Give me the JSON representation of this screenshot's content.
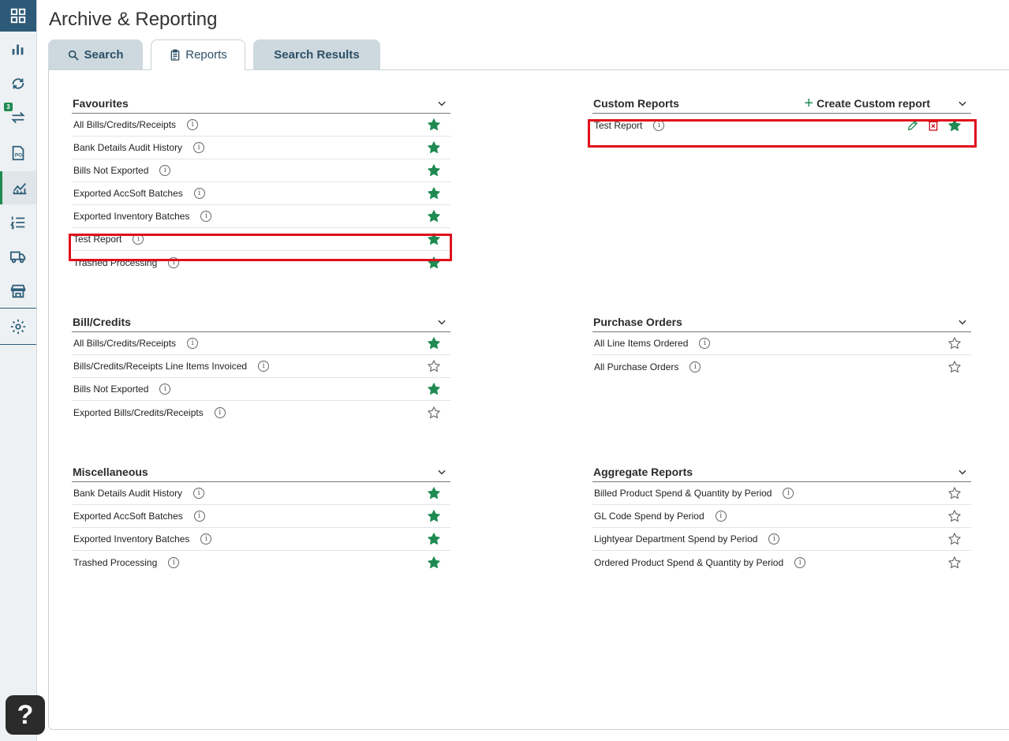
{
  "page": {
    "title": "Archive & Reporting"
  },
  "tabs": [
    {
      "label": "Search"
    },
    {
      "label": "Reports"
    },
    {
      "label": "Search Results"
    }
  ],
  "sidebar": {
    "badge": "3",
    "help": "?"
  },
  "sections": {
    "favourites": {
      "title": "Favourites",
      "items": [
        {
          "label": "All Bills/Credits/Receipts",
          "favourite": true
        },
        {
          "label": "Bank Details Audit History",
          "favourite": true
        },
        {
          "label": "Bills Not Exported",
          "favourite": true
        },
        {
          "label": "Exported AccSoft Batches",
          "favourite": true
        },
        {
          "label": "Exported Inventory Batches",
          "favourite": true
        },
        {
          "label": "Test Report",
          "favourite": true
        },
        {
          "label": "Trashed Processing",
          "favourite": true
        }
      ]
    },
    "custom": {
      "title": "Custom Reports",
      "create_label": "Create Custom report",
      "items": [
        {
          "label": "Test Report",
          "favourite": true
        }
      ]
    },
    "bills": {
      "title": "Bill/Credits",
      "items": [
        {
          "label": "All Bills/Credits/Receipts",
          "favourite": true
        },
        {
          "label": "Bills/Credits/Receipts Line Items Invoiced",
          "favourite": false
        },
        {
          "label": "Bills Not Exported",
          "favourite": true
        },
        {
          "label": "Exported Bills/Credits/Receipts",
          "favourite": false
        }
      ]
    },
    "purchase": {
      "title": "Purchase Orders",
      "items": [
        {
          "label": "All Line Items Ordered",
          "favourite": false
        },
        {
          "label": "All Purchase Orders",
          "favourite": false
        }
      ]
    },
    "misc": {
      "title": "Miscellaneous",
      "items": [
        {
          "label": "Bank Details Audit History",
          "favourite": true
        },
        {
          "label": "Exported AccSoft Batches",
          "favourite": true
        },
        {
          "label": "Exported Inventory Batches",
          "favourite": true
        },
        {
          "label": "Trashed Processing",
          "favourite": true
        }
      ]
    },
    "aggregate": {
      "title": "Aggregate Reports",
      "items": [
        {
          "label": "Billed Product Spend & Quantity by Period",
          "favourite": false
        },
        {
          "label": "GL Code Spend by Period",
          "favourite": false
        },
        {
          "label": "Lightyear Department Spend by Period",
          "favourite": false
        },
        {
          "label": "Ordered Product Spend & Quantity by Period",
          "favourite": false
        }
      ]
    }
  },
  "colors": {
    "accent": "#1f8a52",
    "brand": "#2d5a78",
    "highlight": "#e0101c",
    "danger": "#d0101c"
  }
}
